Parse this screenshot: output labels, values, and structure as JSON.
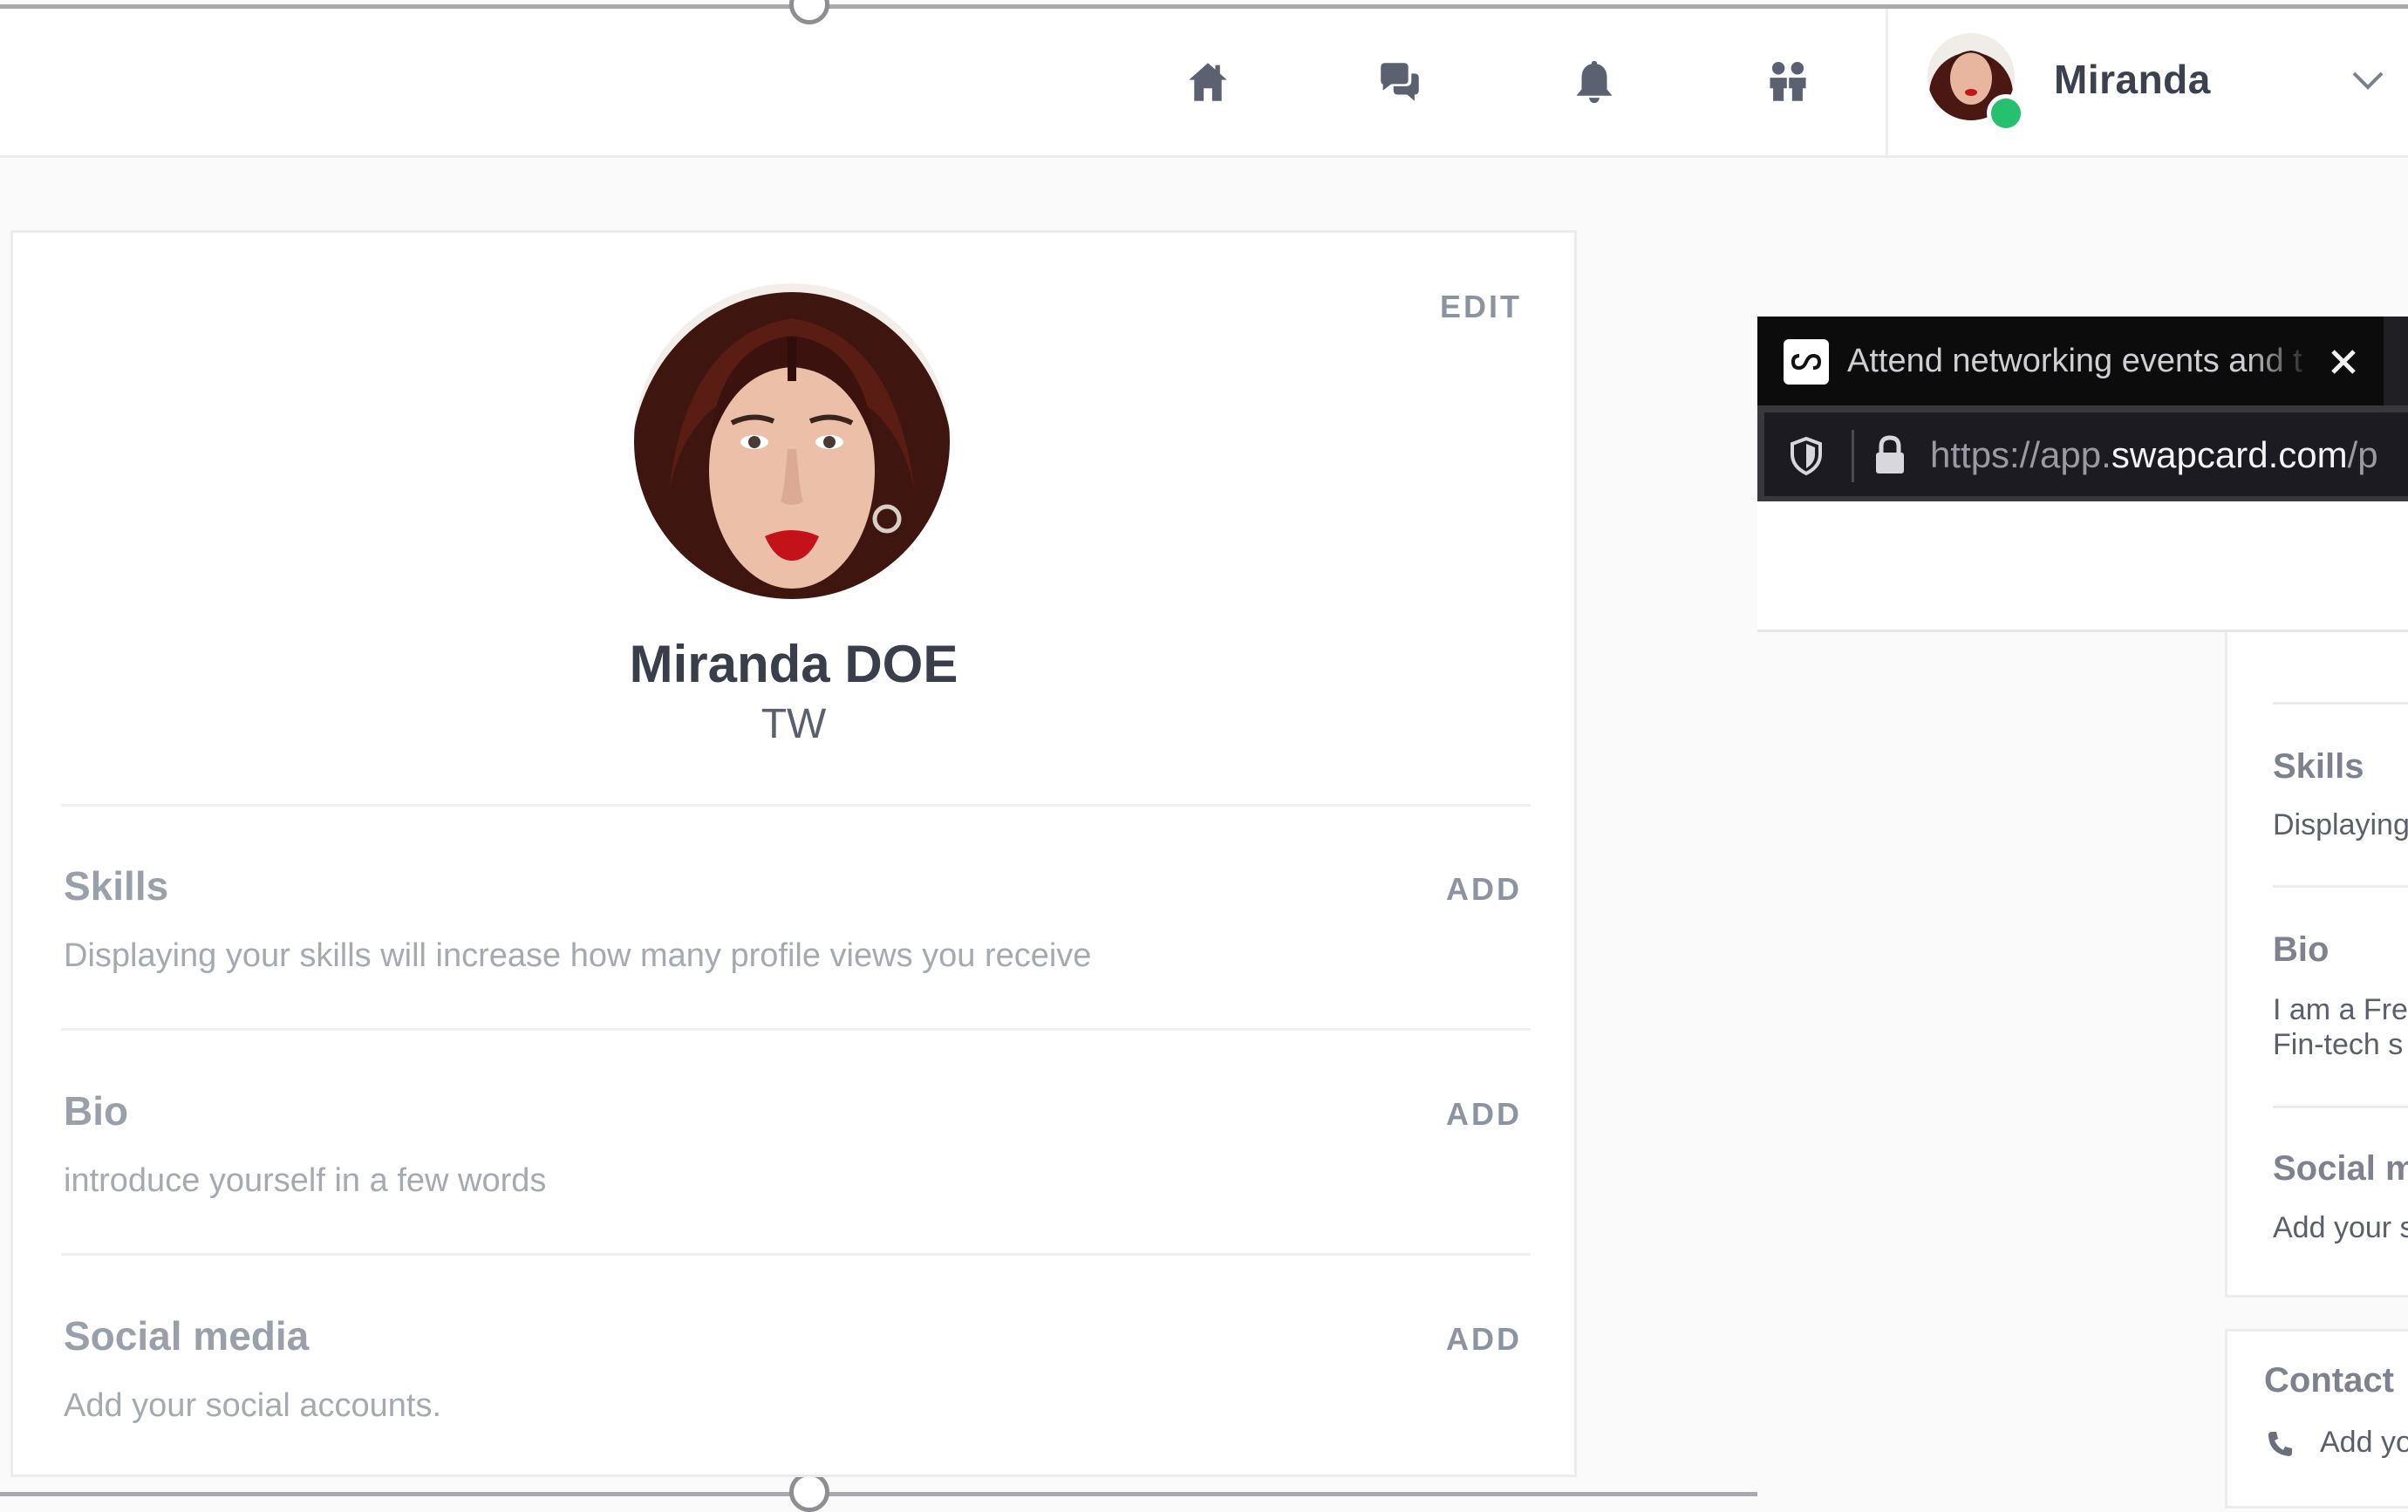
{
  "topbar": {
    "icons": [
      "home-icon",
      "chat-icon",
      "bell-icon",
      "people-icon"
    ],
    "user_name": "Miranda"
  },
  "profile_card": {
    "edit_label": "EDIT",
    "full_name": "Miranda DOE",
    "company": "TW",
    "sections": [
      {
        "title": "Skills",
        "description": "Displaying your skills will increase how many profile views you receive",
        "action": "ADD"
      },
      {
        "title": "Bio",
        "description": "introduce yourself in a few words",
        "action": "ADD"
      },
      {
        "title": "Social media",
        "description": "Add your social accounts.",
        "action": "ADD"
      }
    ]
  },
  "browser_popup": {
    "tab_title": "Attend networking events and t",
    "url_prefix": "https://app.",
    "url_domain": "swapcard.com",
    "url_suffix": "/p"
  },
  "right_panel": {
    "skills_title": "Skills",
    "skills_desc": "Displaying",
    "bio_title": "Bio",
    "bio_line1": "I am a Fre",
    "bio_line2": "Fin-tech s",
    "social_title": "Social m",
    "social_desc": "Add your s",
    "contact_title": "Contact",
    "contact_desc": "Add yo"
  },
  "colors": {
    "online_status": "#25c16f",
    "tab_bar": "#0c0c0d",
    "url_bar": "#38383d"
  }
}
